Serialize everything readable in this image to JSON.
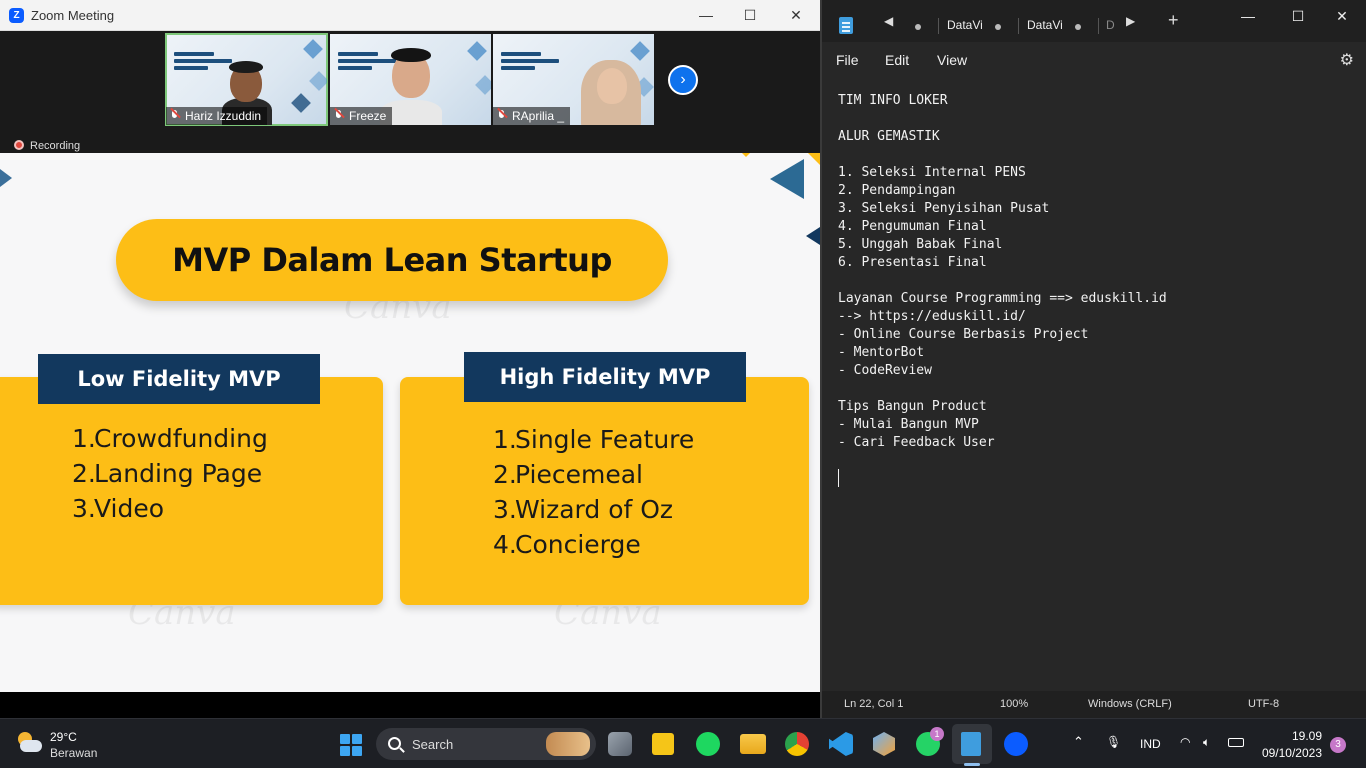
{
  "zoom": {
    "title": "Zoom Meeting",
    "logo_letter": "Z",
    "minimize": "—",
    "maximize": "☐",
    "close": "✕",
    "recording_label": "Recording",
    "next_arrow": "›",
    "participants": [
      {
        "name": "Hariz Izzuddin",
        "muted": false
      },
      {
        "name": "Freeze",
        "muted": true
      },
      {
        "name": "RAprilia _",
        "muted": true
      }
    ],
    "slide": {
      "title": "MVP Dalam Lean Startup",
      "watermark": "Canva",
      "low_fidelity": {
        "header": "Low Fidelity MVP",
        "items": [
          {
            "num": "1.",
            "text": "Crowdfunding"
          },
          {
            "num": "2.",
            "text": "Landing Page"
          },
          {
            "num": "3.",
            "text": "Video"
          }
        ]
      },
      "high_fidelity": {
        "header": "High Fidelity MVP",
        "items": [
          {
            "num": "1.",
            "text": "Single Feature"
          },
          {
            "num": "2.",
            "text": "Piecemeal"
          },
          {
            "num": "3.",
            "text": "Wizard of Oz"
          },
          {
            "num": "4.",
            "text": "Concierge"
          }
        ]
      }
    }
  },
  "notepad": {
    "tabs": [
      "DataVi",
      "DataVi",
      "D"
    ],
    "add_tab": "+",
    "menu": [
      "File",
      "Edit",
      "View"
    ],
    "content_lines": [
      "TIM INFO LOKER",
      "",
      "ALUR GEMASTIK",
      "",
      "1. Seleksi Internal PENS",
      "2. Pendampingan",
      "3. Seleksi Penyisihan Pusat",
      "4. Pengumuman Final",
      "5. Unggah Babak Final",
      "6. Presentasi Final",
      "",
      "Layanan Course Programming ==> eduskill.id",
      "--> https://eduskill.id/",
      "- Online Course Berbasis Project",
      "- MentorBot",
      "- CodeReview",
      "",
      "Tips Bangun Product",
      "- Mulai Bangun MVP",
      "- Cari Feedback User"
    ],
    "status": {
      "position": "Ln 22, Col 1",
      "zoom": "100%",
      "line_ending": "Windows (CRLF)",
      "encoding": "UTF-8"
    }
  },
  "taskbar": {
    "weather_temp": "29°C",
    "weather_desc": "Berawan",
    "search_label": "Search",
    "whatsapp_badge": "1",
    "tray_lang": "IND",
    "time": "19.09",
    "date": "09/10/2023",
    "notification_count": "3"
  },
  "colors": {
    "slide_yellow": "#fdbe16",
    "slide_navy": "#12385e",
    "zoom_blue": "#0b5cff",
    "notepad_bg": "#272727"
  }
}
